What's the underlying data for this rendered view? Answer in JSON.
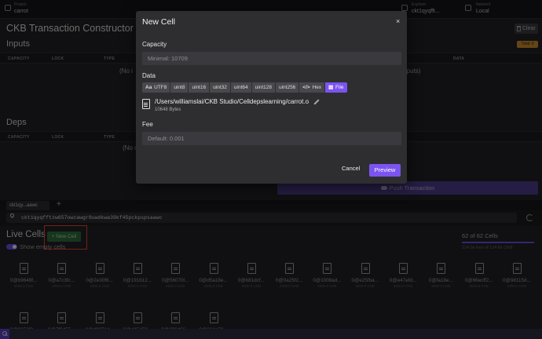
{
  "header": {
    "project_label": "Project",
    "project_value": "carrot",
    "explorer_label": "Explorer",
    "explorer_value": "ckt1qyqfft...",
    "network_label": "Network",
    "network_value": "Local"
  },
  "constructor": {
    "title": "CKB Transaction Constructor",
    "clear_label": "Clear",
    "inputs_title": "Inputs",
    "inputs_columns": [
      "CAPACITY",
      "LOCK",
      "TYPE"
    ],
    "inputs_empty": "(No i",
    "outputs_columns": [
      "DATA"
    ],
    "outputs_empty": "utputs)",
    "total_badge": "Total: 0",
    "deps_title": "Deps",
    "deps_columns": [
      "CAPACITY",
      "LOCK",
      "TYPE"
    ],
    "deps_empty": "(No c",
    "push_label": "Push Transaction"
  },
  "explorer": {
    "tab_label": "ckt1qy...aawc",
    "tab_add": "+",
    "address": "ckt1qyqfftzw657owzawgr8uwdkwa39kf45pckpspsaawc",
    "live_cells_title": "Live Cells",
    "new_cell_label": "+ New Cell",
    "show_empty_label": "Show empty cells",
    "cells_count": "62 of 62 Cells",
    "capacity_text": "124.6k free of 124.6k CKB",
    "capacity_fraction": 1.0,
    "cells": [
      {
        "id": "0@b9649f...",
        "cap": "2000.0 CKB"
      },
      {
        "id": "0@a7c3fc...",
        "cap": "2000.0 CKB"
      },
      {
        "id": "0@2e30f8...",
        "cap": "2000.0 CKB"
      },
      {
        "id": "0@191b12...",
        "cap": "2000.0 CKB"
      },
      {
        "id": "0@56070l...",
        "cap": "2000.0 CKB"
      },
      {
        "id": "0@d5a18e...",
        "cap": "2000.0 CKB"
      },
      {
        "id": "0@b81dcf...",
        "cap": "2000.0 CKB"
      },
      {
        "id": "0@0a25f2...",
        "cap": "2000.0 CKB"
      },
      {
        "id": "0@1008ad...",
        "cap": "2000.0 CKB"
      },
      {
        "id": "0@e25fba...",
        "cap": "2000.0 CKB"
      },
      {
        "id": "0@e47efd...",
        "cap": "2000.0 CKB"
      },
      {
        "id": "0@fa18e...",
        "cap": "2000.0 CKB"
      },
      {
        "id": "0@66ecff2...",
        "cap": "2000.0 CKB"
      },
      {
        "id": "0@98115d...",
        "cap": "2000.0 CKB"
      },
      {
        "id": "0@8656f3...",
        "cap": "2000.0 CKB"
      },
      {
        "id": "0@7f9d55...",
        "cap": "2000.0 CKB"
      },
      {
        "id": "0@d8871d...",
        "cap": "2000.0 CKB"
      },
      {
        "id": "0@d45450...",
        "cap": "2000.0 CKB"
      },
      {
        "id": "0@396d66...",
        "cap": "2000.0 CKB"
      },
      {
        "id": "0@624a50...",
        "cap": "2000.0 CKB"
      }
    ]
  },
  "modal": {
    "title": "New Cell",
    "close": "×",
    "capacity_label": "Capacity",
    "capacity_placeholder": "Minimal: 10709",
    "data_label": "Data",
    "formats": [
      {
        "glyph": "Aa",
        "label": "UTF8",
        "active": false
      },
      {
        "glyph": "",
        "label": "uint8",
        "active": false
      },
      {
        "glyph": "",
        "label": "uint16",
        "active": false
      },
      {
        "glyph": "",
        "label": "uint32",
        "active": false
      },
      {
        "glyph": "",
        "label": "uint64",
        "active": false
      },
      {
        "glyph": "",
        "label": "uint128",
        "active": false
      },
      {
        "glyph": "",
        "label": "uint256",
        "active": false
      },
      {
        "glyph": "</>",
        "label": "Hex",
        "active": false
      },
      {
        "glyph": "▤",
        "label": "File",
        "active": true
      }
    ],
    "file_path": "/Users/williamslai/CKB Studio/Celldepslearning/carrot.o",
    "file_size": "10648 Bytes",
    "fee_label": "Fee",
    "fee_placeholder": "Default: 0.001",
    "cancel_label": "Cancel",
    "preview_label": "Preview"
  }
}
